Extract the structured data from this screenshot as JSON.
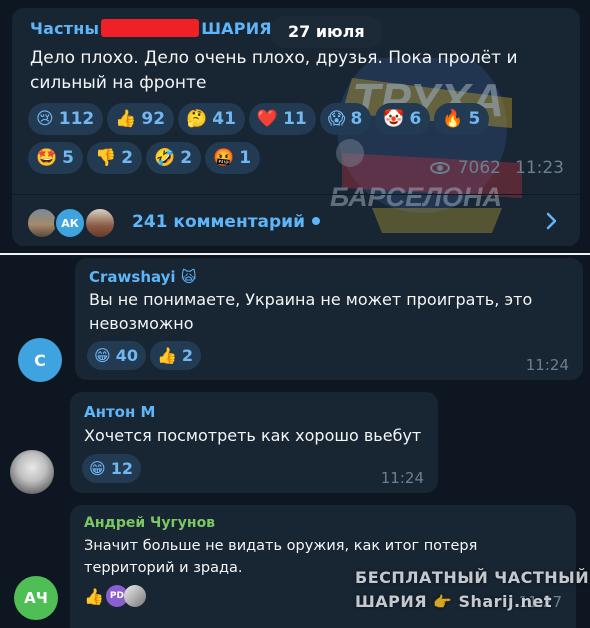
{
  "post": {
    "author_visible_start": "Частны",
    "author_visible_end": "ШАРИЯ",
    "date": "27 июля",
    "text": "Дело плохо. Дело очень плохо, друзья. Пока пролёт и сильный на фронте",
    "reactions_row1": [
      {
        "emoji": "😢",
        "count": "112"
      },
      {
        "emoji": "👍",
        "count": "92"
      },
      {
        "emoji": "🤔",
        "count": "41"
      },
      {
        "emoji": "❤️",
        "count": "11"
      },
      {
        "emoji": "😱",
        "count": "8"
      },
      {
        "emoji": "🤡",
        "count": "6"
      },
      {
        "emoji": "🔥",
        "count": "5"
      }
    ],
    "reactions_row2": [
      {
        "emoji": "🤩",
        "count": "5"
      },
      {
        "emoji": "👎",
        "count": "2"
      },
      {
        "emoji": "🤣",
        "count": "2"
      },
      {
        "emoji": "🤬",
        "count": "1"
      }
    ],
    "views": "7062",
    "time": "11:23",
    "commenter_avatar_initials": "АК",
    "comments_label": "241 комментарий",
    "watermark_top": "ТРУХА",
    "watermark_bottom": "БАРСЕЛОНА"
  },
  "comments": [
    {
      "name": "Crawshayi",
      "name_badge": "🙀",
      "avatar_initial": "C",
      "avatar_color": "#3fa3e0",
      "name_color": "#5eb5f7",
      "text": "Вы не понимаете, Украина не может проиграть, это невозможно",
      "reactions": [
        {
          "emoji": "😁",
          "count": "40"
        },
        {
          "emoji": "👍",
          "count": "2"
        }
      ],
      "time": "11:24"
    },
    {
      "name": "Антон М",
      "name_color": "#5eb5f7",
      "text": "Хочется посмотреть как хорошо вьебут",
      "reactions": [
        {
          "emoji": "😁",
          "count": "12"
        }
      ],
      "time": "11:24"
    },
    {
      "name": "Андрей Чугунов",
      "avatar_initial": "АЧ",
      "avatar_color": "#4fbe54",
      "name_color": "#7bc862",
      "text": "Значит больше не видать оружия, как итог потеря территорий и зрада.",
      "reactions_label": "👍",
      "reactor_initials": "PD",
      "time": "11:27"
    }
  ],
  "watermark": {
    "line1": "БЕСПЛАТНЫЙ ЧАСТНЫЙ",
    "line2": "ШАРИЯ",
    "line2_suffix": "Sharij.net"
  },
  "colors": {
    "background": "#0e1621",
    "bubble": "#182533",
    "accent": "#5eb5f7",
    "reaction_bg": "#223a52",
    "muted": "#6d7f8f"
  }
}
